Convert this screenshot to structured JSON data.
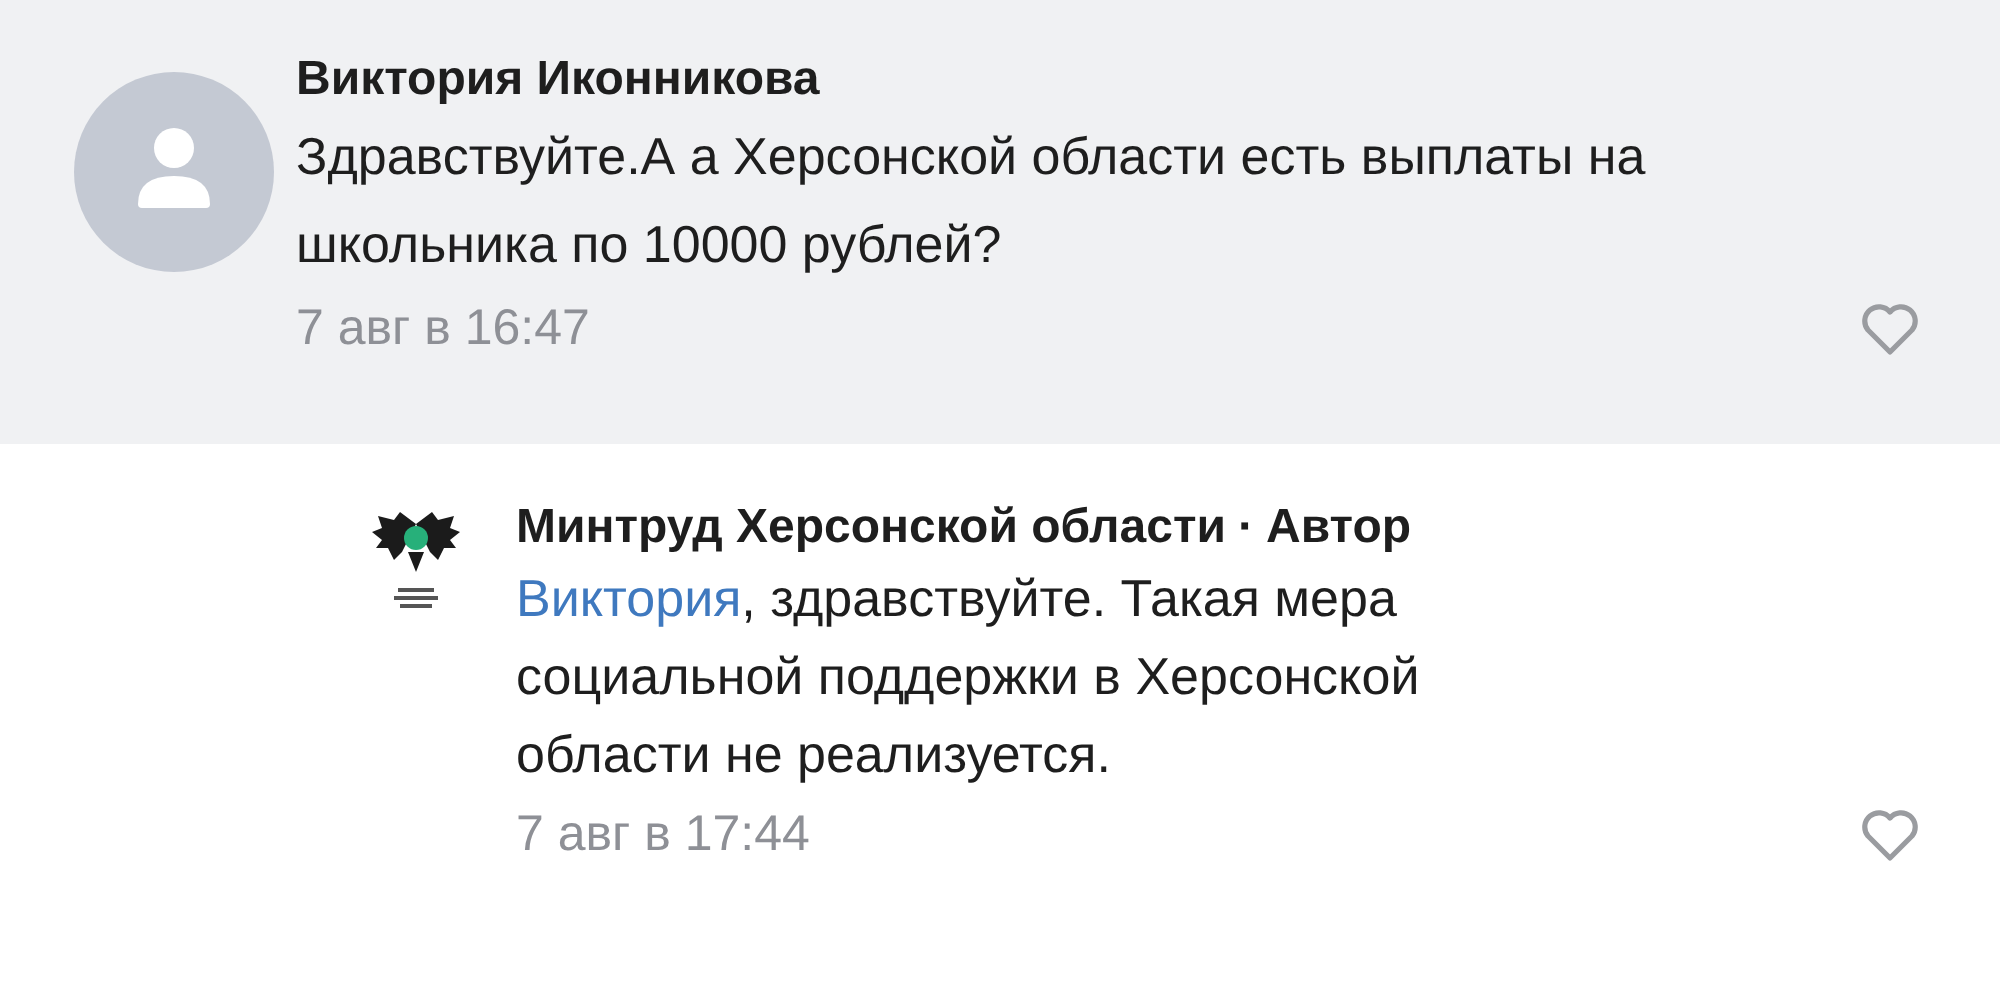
{
  "comments": [
    {
      "author": "Виктория Иконникова",
      "text": "Здравствуйте.А а Херсонской области есть выплаты на школьника по 10000 рублей?",
      "time": "7 авг в 16:47",
      "liked": false,
      "kind": "comment",
      "highlighted": true
    },
    {
      "author": "Минтруд Херсонской области",
      "separator": "·",
      "author_tag": "Автор",
      "mention": "Виктория",
      "text": ", здравствуйте. Такая мера социальной поддержки в Херсонской области не реализуется.",
      "time": "7 авг в 17:44",
      "liked": false,
      "kind": "reply",
      "highlighted": false
    }
  ]
}
